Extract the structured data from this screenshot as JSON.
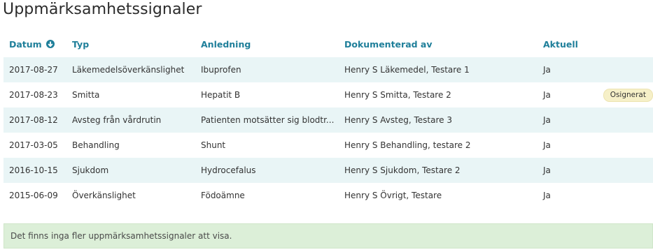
{
  "page": {
    "title": "Uppmärksamhetssignaler"
  },
  "table": {
    "headers": {
      "datum": "Datum",
      "typ": "Typ",
      "anledning": "Anledning",
      "dokumenterad_av": "Dokumenterad av",
      "aktuell": "Aktuell"
    },
    "sort_icon": "arrow-down-circle-icon",
    "rows": [
      {
        "datum": "2017-08-27",
        "typ": "Läkemedelsöverkänslighet",
        "anledning": "Ibuprofen",
        "dokumenterad_av": "Henry S Läkemedel, Testare 1",
        "aktuell": "Ja",
        "badge": ""
      },
      {
        "datum": "2017-08-23",
        "typ": "Smitta",
        "anledning": "Hepatit B",
        "dokumenterad_av": "Henry S Smitta, Testare 2",
        "aktuell": "Ja",
        "badge": "Osignerat"
      },
      {
        "datum": "2017-08-12",
        "typ": "Avsteg från vårdrutin",
        "anledning": "Patienten motsätter sig blodtr...",
        "dokumenterad_av": "Henry S Avsteg, Testare 3",
        "aktuell": "Ja",
        "badge": ""
      },
      {
        "datum": "2017-03-05",
        "typ": "Behandling",
        "anledning": "Shunt",
        "dokumenterad_av": "Henry S Behandling, testare 2",
        "aktuell": "Ja",
        "badge": ""
      },
      {
        "datum": "2016-10-15",
        "typ": "Sjukdom",
        "anledning": "Hydrocefalus",
        "dokumenterad_av": "Henry S Sjukdom, Testare 2",
        "aktuell": "Ja",
        "badge": ""
      },
      {
        "datum": "2015-06-09",
        "typ": "Överkänslighet",
        "anledning": "Födoämne",
        "dokumenterad_av": "Henry S Övrigt, Testare",
        "aktuell": "Ja",
        "badge": ""
      }
    ]
  },
  "footer": {
    "message": "Det finns inga fler uppmärksamhetssignaler att visa."
  },
  "colors": {
    "header_text": "#1f7f9a",
    "row_stripe": "#e9f5f6",
    "badge_bg": "#f6f0c8",
    "alert_bg": "#dcefd8"
  }
}
